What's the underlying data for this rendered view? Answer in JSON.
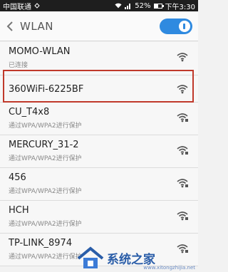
{
  "status_bar": {
    "carrier": "中国联通",
    "battery": "52%",
    "battery_fraction": 0.52,
    "time": "下午3:30"
  },
  "header": {
    "title": "WLAN",
    "toggle_on": true
  },
  "networks": [
    {
      "name": "MOMO-WLAN",
      "status": "已连接"
    },
    {
      "name": "360WiFi-6225BF",
      "status": ""
    },
    {
      "name": "CU_T4x8",
      "status": "通过WPA/WPA2进行保护"
    },
    {
      "name": "MERCURY_31-2",
      "status": "通过WPA/WPA2进行保护"
    },
    {
      "name": "456",
      "status": "通过WPA/WPA2进行保护"
    },
    {
      "name": "HCH",
      "status": "通过WPA/WPA2进行保护"
    },
    {
      "name": "TP-LINK_8974",
      "status": "通过WPA/WPA2进行保护"
    }
  ],
  "watermark": {
    "text": "系统之家",
    "url": "www.xitongzhijia.net"
  },
  "colors": {
    "accent": "#2f8ae0",
    "highlight": "#c0392b"
  }
}
